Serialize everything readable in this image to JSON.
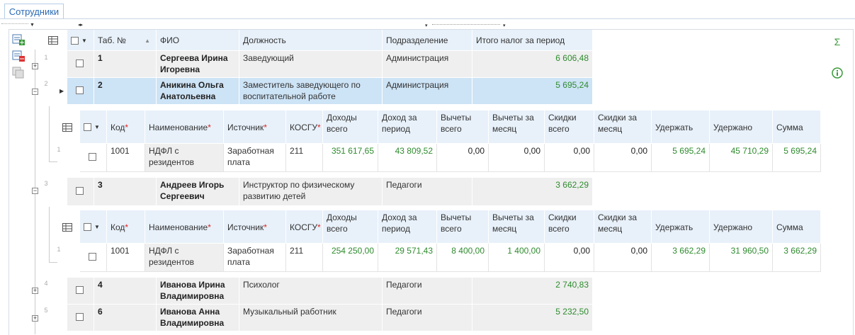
{
  "tab": {
    "label": "Сотрудники"
  },
  "main": {
    "columns": [
      "Таб. №",
      "ФИО",
      "Должность",
      "Подразделение",
      "Итого налог за период"
    ],
    "rows": [
      {
        "rownum": "1",
        "tab": "1",
        "fio": "Сергеева Ирина Игоревна",
        "position": "Заведующий",
        "dept": "Администрация",
        "total": "6 606,48"
      },
      {
        "rownum": "2",
        "tab": "2",
        "fio": "Аникина Ольга Анатольевна",
        "position": "Заместитель заведующего по воспитательной работе",
        "dept": "Администрация",
        "total": "5 695,24"
      },
      {
        "rownum": "3",
        "tab": "3",
        "fio": "Андреев Игорь Сергеевич",
        "position": "Инструктор по физическому развитию детей",
        "dept": "Педагоги",
        "total": "3 662,29"
      },
      {
        "rownum": "4",
        "tab": "4",
        "fio": "Иванова Ирина Владимировна",
        "position": "Психолог",
        "dept": "Педагоги",
        "total": "2 740,83"
      },
      {
        "rownum": "5",
        "tab": "6",
        "fio": "Иванова Анна Владимировна",
        "position": "Музыкальный работник",
        "dept": "Педагоги",
        "total": "5 232,50"
      }
    ]
  },
  "detail": {
    "columns": {
      "code": "Код",
      "name": "Наименование",
      "source": "Источник",
      "kosgu": "КОСГУ",
      "income_total": "Доходы всего",
      "income_period": "Доход за период",
      "deductions_total": "Вычеты всего",
      "deductions_month": "Вычеты за месяц",
      "discounts_total": "Скидки всего",
      "discounts_month": "Скидки за месяц",
      "to_withhold": "Удержать",
      "withheld": "Удержано",
      "sum": "Сумма"
    },
    "row2": {
      "rownum": "1",
      "code": "1001",
      "name": "НДФЛ с резидентов",
      "source": "Заработная плата",
      "kosgu": "211",
      "income_total": "351 617,65",
      "income_period": "43 809,52",
      "deductions_total": "0,00",
      "deductions_month": "0,00",
      "discounts_total": "0,00",
      "discounts_month": "0,00",
      "to_withhold": "5 695,24",
      "withheld": "45 710,29",
      "sum": "5 695,24"
    },
    "row3": {
      "rownum": "1",
      "code": "1001",
      "name": "НДФЛ с резидентов",
      "source": "Заработная плата",
      "kosgu": "211",
      "income_total": "254 250,00",
      "income_period": "29 571,43",
      "deductions_total": "8 400,00",
      "deductions_month": "1 400,00",
      "discounts_total": "0,00",
      "discounts_month": "0,00",
      "to_withhold": "3 662,29",
      "withheld": "31 960,50",
      "sum": "3 662,29"
    }
  },
  "colors": {
    "accent": "#2a6bb5",
    "header_bg": "#e8f1fa",
    "selected_bg": "#cde3f6",
    "value_green": "#2e8b2e",
    "required_red": "#d22222"
  }
}
